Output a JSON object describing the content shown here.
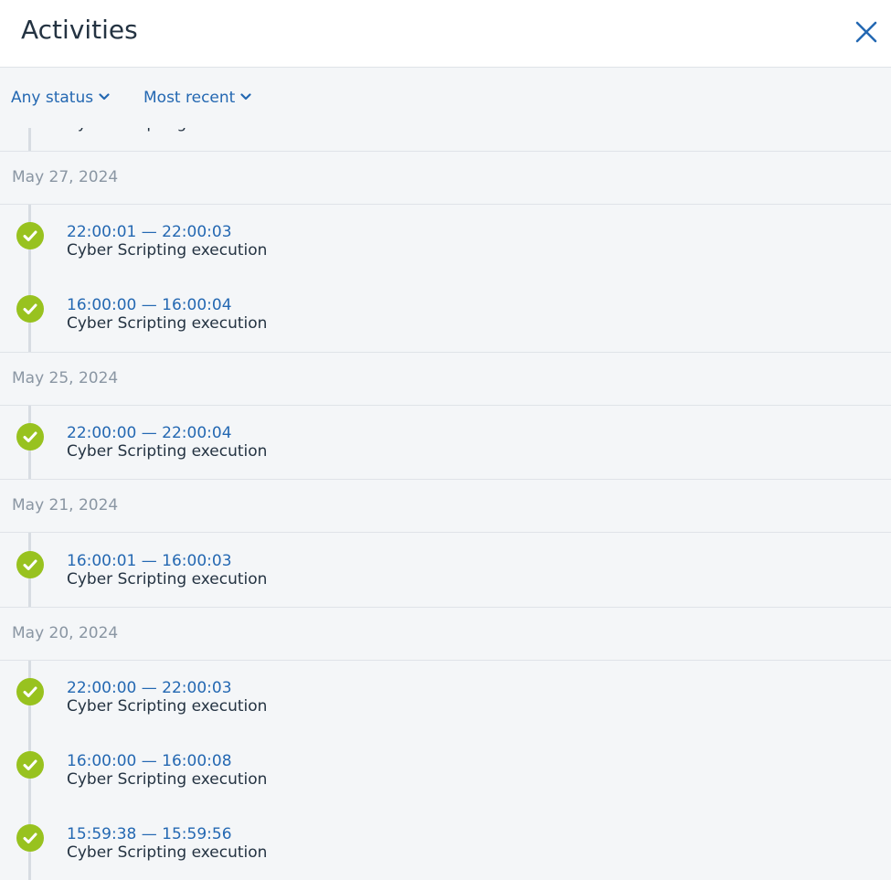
{
  "header": {
    "title": "Activities",
    "close_icon": "close-icon"
  },
  "filters": {
    "status_label": "Any status",
    "sort_label": "Most recent"
  },
  "colors": {
    "accent": "#2468b2",
    "success": "#98c21f",
    "muted": "#8a96a3",
    "text": "#243342"
  },
  "cut_item": {
    "description": "Cyber Scripting execution"
  },
  "groups": [
    {
      "date": "May 27, 2024",
      "items": [
        {
          "time": "22:00:01 — 22:00:03",
          "description": "Cyber Scripting execution",
          "status": "success"
        },
        {
          "time": "16:00:00 — 16:00:04",
          "description": "Cyber Scripting execution",
          "status": "success"
        }
      ]
    },
    {
      "date": "May 25, 2024",
      "items": [
        {
          "time": "22:00:00 — 22:00:04",
          "description": "Cyber Scripting execution",
          "status": "success"
        }
      ]
    },
    {
      "date": "May 21, 2024",
      "items": [
        {
          "time": "16:00:01 — 16:00:03",
          "description": "Cyber Scripting execution",
          "status": "success"
        }
      ]
    },
    {
      "date": "May 20, 2024",
      "items": [
        {
          "time": "22:00:00 — 22:00:03",
          "description": "Cyber Scripting execution",
          "status": "success"
        },
        {
          "time": "16:00:00 — 16:00:08",
          "description": "Cyber Scripting execution",
          "status": "success"
        },
        {
          "time": "15:59:38 — 15:59:56",
          "description": "Cyber Scripting execution",
          "status": "success"
        }
      ]
    }
  ]
}
